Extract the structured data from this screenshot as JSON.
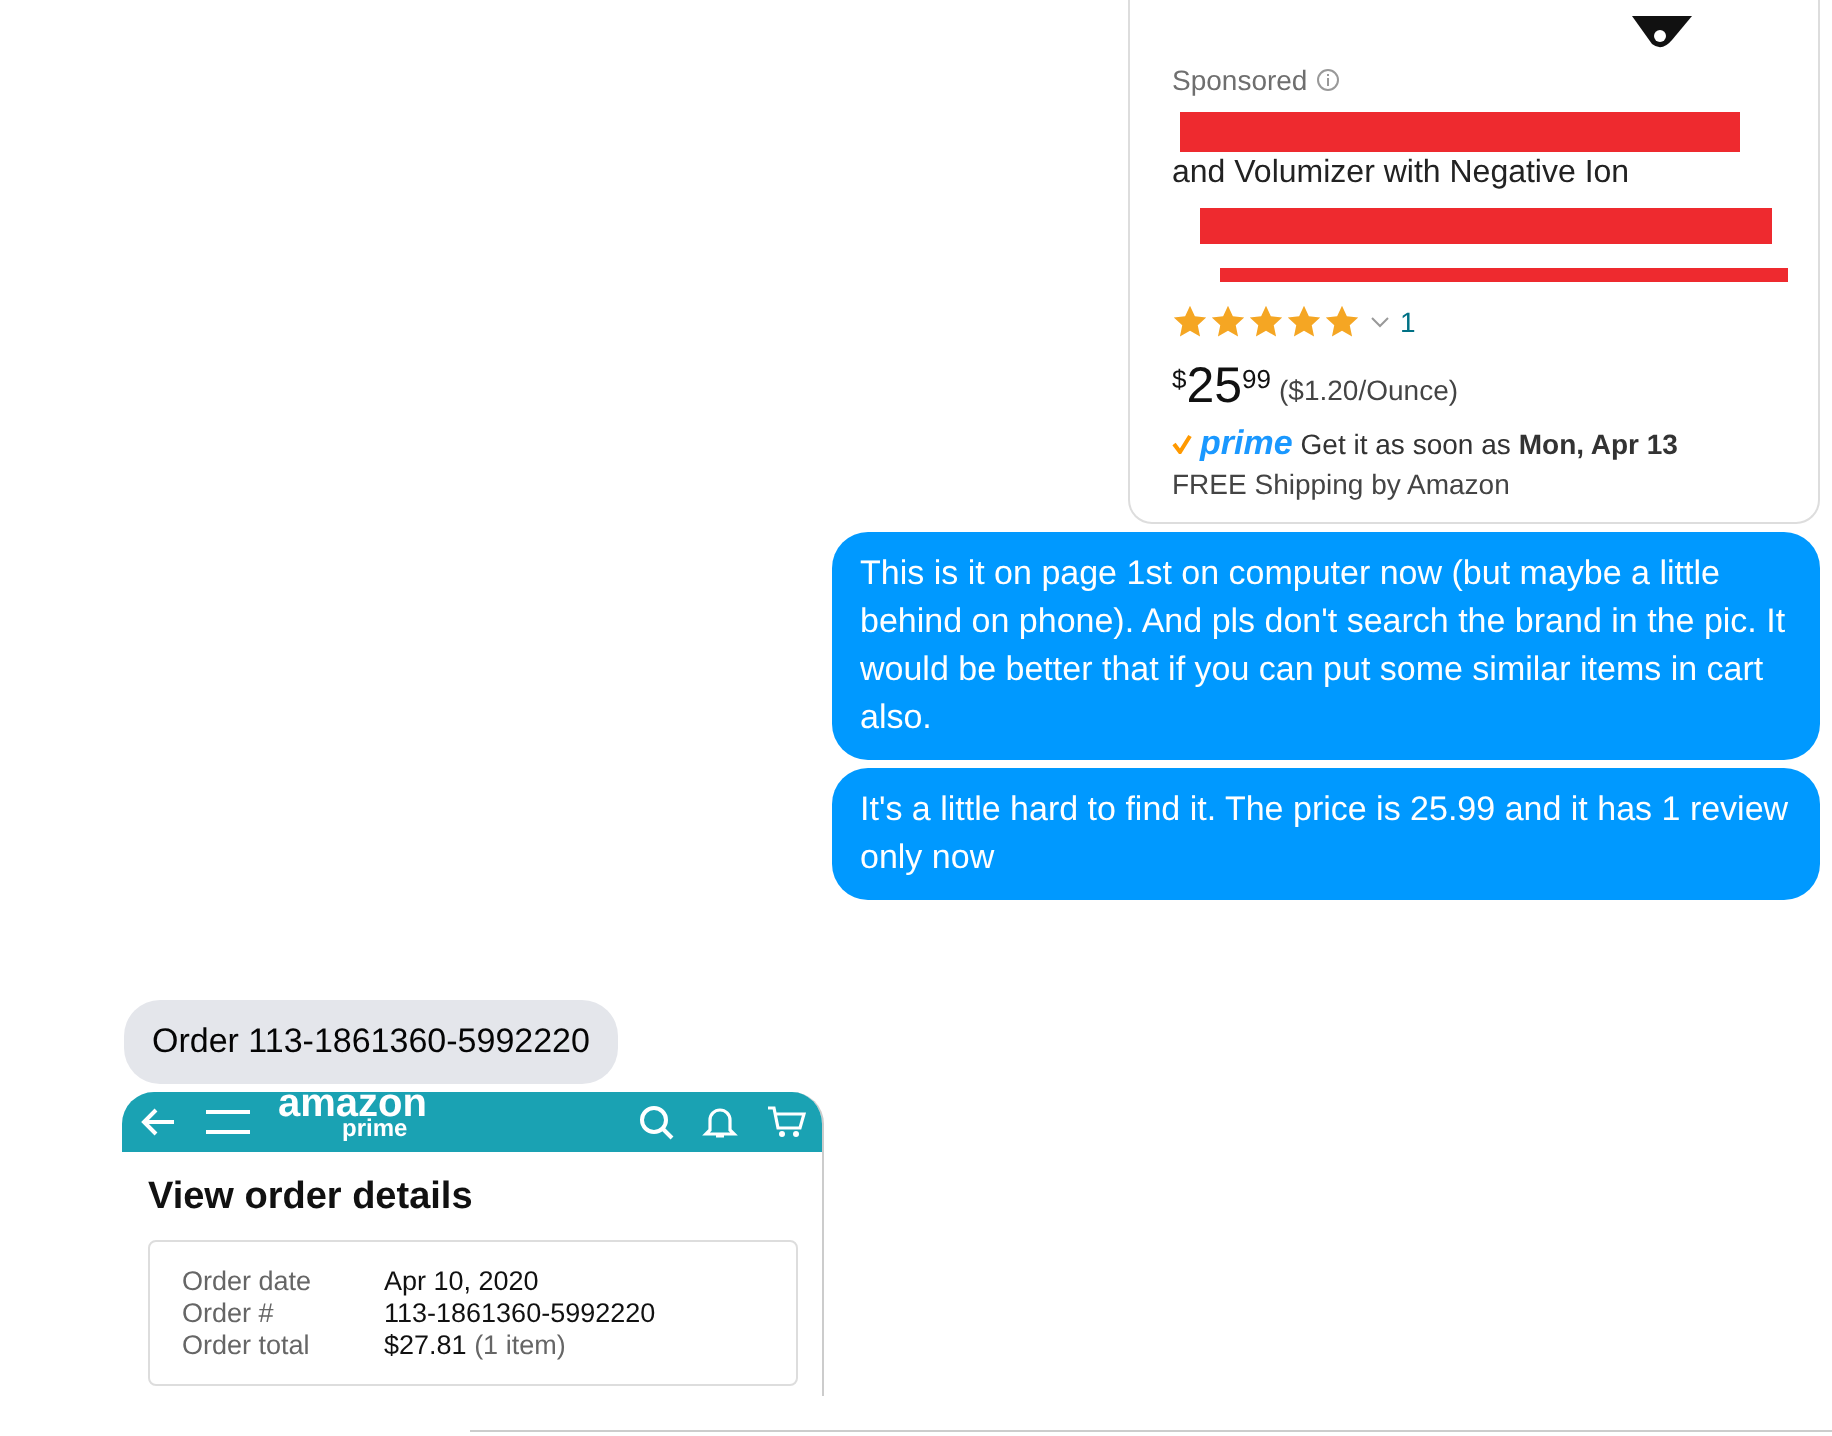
{
  "product_card": {
    "sponsored": "Sponsored",
    "title_lines": [
      "and Volumizer with Negative Ion"
    ],
    "stars": 5,
    "review_count": "1",
    "price": {
      "symbol": "$",
      "whole": "25",
      "fraction": "99"
    },
    "unit_price": "($1.20/Ounce)",
    "prime": "prime",
    "delivery": "Get it as soon as",
    "delivery_date": "Mon, Apr 13",
    "shipping": "FREE Shipping by Amazon"
  },
  "messages": [
    {
      "kind": "sent",
      "text": "This is it on page 1st on computer now (but maybe a little behind on phone). And pls don't search the brand in the pic. It would be better that if you can put some similar items in cart also."
    },
    {
      "kind": "sent",
      "text": "It's a little hard to find it.  The price is 25.99 and it has 1 review only now"
    },
    {
      "kind": "received",
      "text": "Order 113-1861360-5992220"
    }
  ],
  "order_screenshot": {
    "logo": "amazon",
    "logo_sub": "prime",
    "title": "View order details",
    "rows": [
      {
        "label": "Order date",
        "value": "Apr 10, 2020"
      },
      {
        "label": "Order #",
        "value": "113-1861360-5992220"
      },
      {
        "label": "Order total",
        "value": "$27.81",
        "note": "(1 item)"
      }
    ]
  }
}
